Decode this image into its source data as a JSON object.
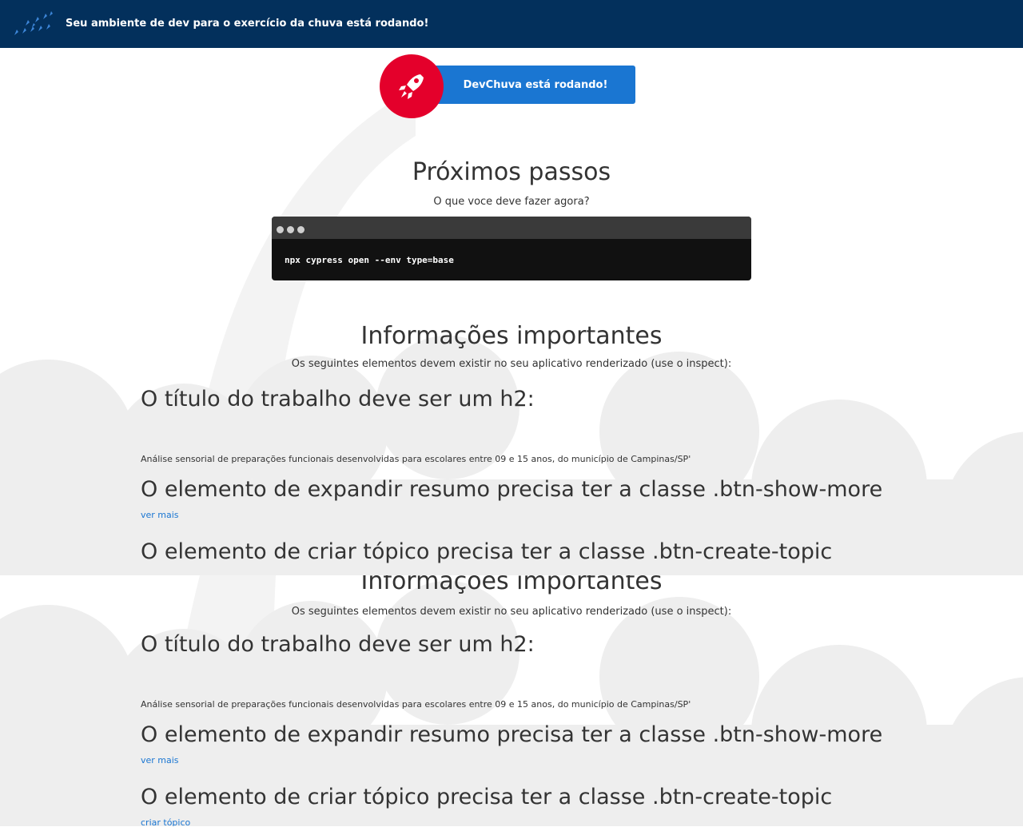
{
  "header": {
    "title": "Seu ambiente de dev para o exercício da chuva está rodando!",
    "logo_icon": "rain-drops-icon"
  },
  "badge": {
    "label": "DevChuva está rodando!",
    "icon": "rocket-icon"
  },
  "next_steps": {
    "title": "Próximos passos",
    "subtitle": "O que voce deve fazer agora?"
  },
  "terminal": {
    "command": "npx cypress open --env type=base"
  },
  "info": {
    "title": "Informações importantes",
    "subtitle": "Os seguintes elementos devem existir no seu aplicativo renderizado (use o inspect):",
    "h2_title": "O título do trabalho deve ser um h2:",
    "work_title": "Análise sensorial de preparações funcionais desenvolvidas para escolares entre 09 e 15 anos, do município de Campinas/SP'",
    "show_more_title": "O elemento de expandir resumo precisa ter a classe .btn-show-more",
    "show_more_link": "ver mais",
    "create_topic_title": "O elemento de criar tópico precisa ter a classe .btn-create-topic",
    "create_topic_link": "criar tópico"
  },
  "colors": {
    "header": "#03305c",
    "button": "#1a76d2",
    "rocket": "#e4002b",
    "cloud": "#eeeeee"
  }
}
